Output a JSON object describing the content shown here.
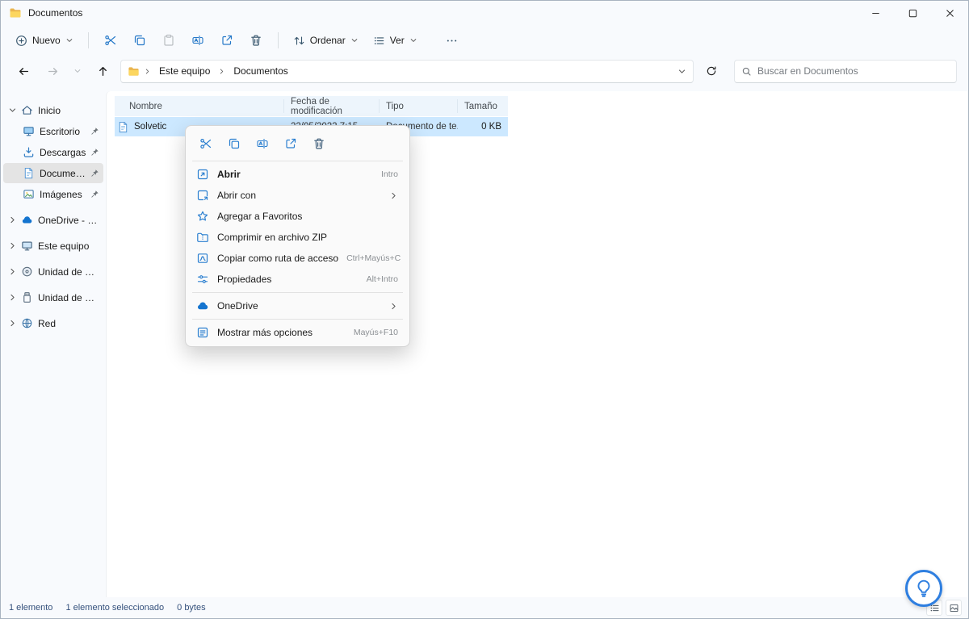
{
  "window": {
    "title": "Documentos"
  },
  "toolbar": {
    "new": "Nuevo",
    "sort": "Ordenar",
    "view": "Ver"
  },
  "nav": {
    "breadcrumb": [
      "Este equipo",
      "Documentos"
    ],
    "search_placeholder": "Buscar en Documentos"
  },
  "sidebar": {
    "items": [
      {
        "label": "Inicio"
      },
      {
        "label": "Escritorio"
      },
      {
        "label": "Descargas"
      },
      {
        "label": "Documentos"
      },
      {
        "label": "Imágenes"
      },
      {
        "label": "OneDrive - Personal"
      },
      {
        "label": "Este equipo"
      },
      {
        "label": "Unidad de DVD (D:)"
      },
      {
        "label": "Unidad de USB (E:)"
      },
      {
        "label": "Red"
      }
    ]
  },
  "list": {
    "columns": {
      "name": "Nombre",
      "date": "Fecha de modificación",
      "type": "Tipo",
      "size": "Tamaño"
    },
    "rows": [
      {
        "name": "Solvetic",
        "date": "22/05/2022 7:15",
        "type": "Documento de te...",
        "size": "0 KB"
      }
    ]
  },
  "menu": {
    "items": [
      {
        "label": "Abrir",
        "shortcut": "Intro"
      },
      {
        "label": "Abrir con"
      },
      {
        "label": "Agregar a Favoritos"
      },
      {
        "label": "Comprimir en archivo ZIP"
      },
      {
        "label": "Copiar como ruta de acceso",
        "shortcut": "Ctrl+Mayús+C"
      },
      {
        "label": "Propiedades",
        "shortcut": "Alt+Intro"
      },
      {
        "label": "OneDrive"
      },
      {
        "label": "Mostrar más opciones",
        "shortcut": "Mayús+F10"
      }
    ]
  },
  "statusbar": {
    "count": "1 elemento",
    "selected": "1 elemento seleccionado",
    "size": "0 bytes"
  },
  "colors": {
    "accent": "#0b77d4",
    "selection": "#cce8ff"
  }
}
